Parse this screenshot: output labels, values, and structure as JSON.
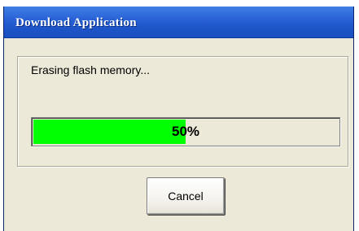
{
  "window": {
    "title": "Download Application"
  },
  "main": {
    "status_text": "Erasing flash memory...",
    "progress": {
      "value_percent": 50,
      "label": "50%",
      "fill_color": "#00ff00"
    }
  },
  "buttons": {
    "cancel_label": "Cancel"
  },
  "colors": {
    "titlebar": "#2a63d6",
    "dialog_background": "#ece9d8"
  }
}
